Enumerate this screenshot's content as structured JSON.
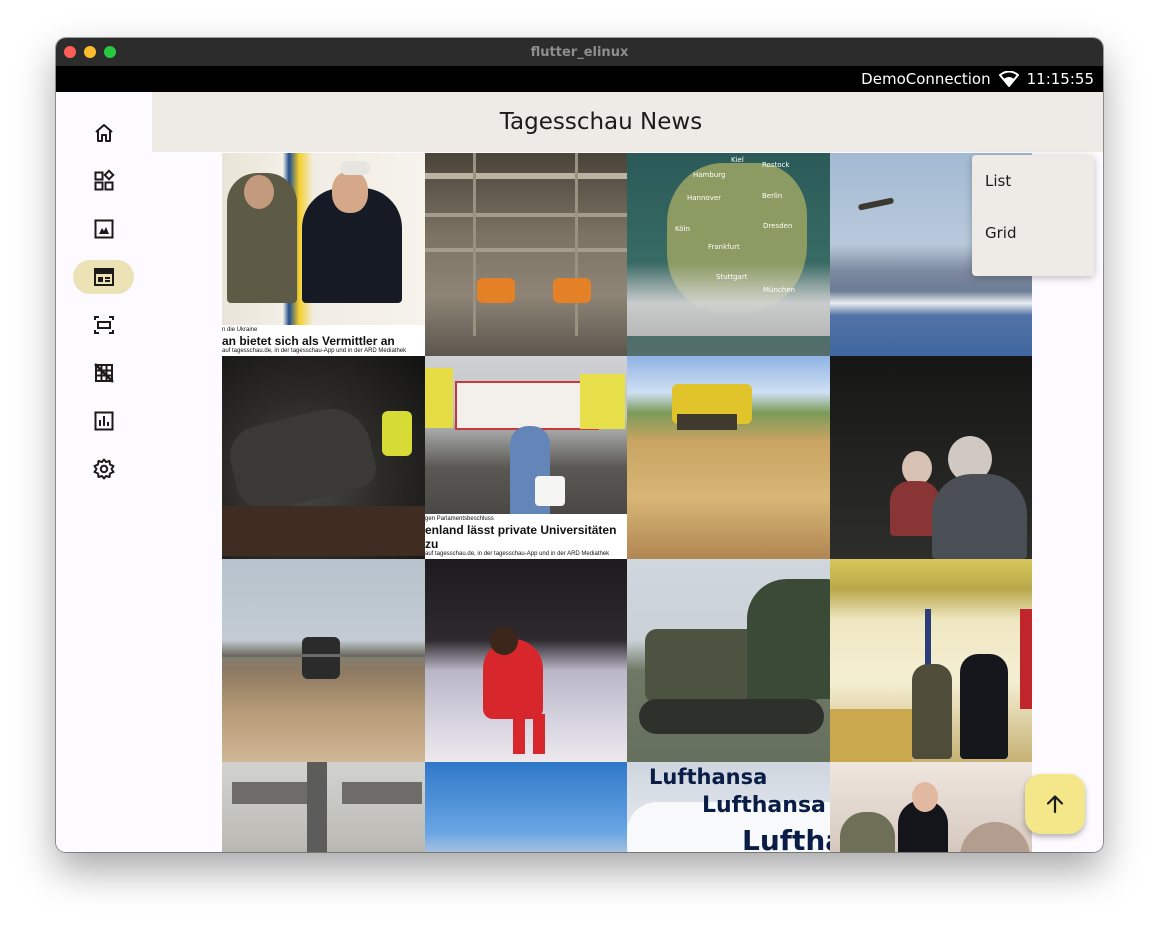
{
  "window": {
    "title": "flutter_elinux"
  },
  "status_bar": {
    "connection": "DemoConnection",
    "time": "11:15:55",
    "wifi_icon": "wifi-icon"
  },
  "nav_rail": {
    "selected_index": 3,
    "items": [
      {
        "icon": "home-icon"
      },
      {
        "icon": "widgets-icon"
      },
      {
        "icon": "gallery-icon"
      },
      {
        "icon": "news-icon"
      },
      {
        "icon": "fit-screen-icon"
      },
      {
        "icon": "grid-off-icon"
      },
      {
        "icon": "chart-icon"
      },
      {
        "icon": "settings-icon"
      }
    ]
  },
  "app_bar": {
    "title": "Tagesschau News"
  },
  "view_menu": {
    "items": [
      {
        "label": "List"
      },
      {
        "label": "Grid"
      }
    ]
  },
  "news_grid": {
    "tiles": [
      {
        "subject": "Zelensky and Erdogan handshake",
        "caption_kicker": "n die Ukraine",
        "caption_headline": "an bietet sich als Vermittler an",
        "caption_source": "auf tagesschau.de, in der tagesschau-App und in der ARD Mediathek"
      },
      {
        "subject": "empty train car with orange seats"
      },
      {
        "subject": "weather map of Germany",
        "map_cities": [
          "Kiel",
          "Rostock",
          "Hamburg",
          "Hannover",
          "Berlin",
          "Köln",
          "Frankfurt",
          "Dresden",
          "Stuttgart",
          "München"
        ]
      },
      {
        "subject": "missile over coastline"
      },
      {
        "subject": "burned car wreck at night with police"
      },
      {
        "subject": "protest with banners",
        "caption_kicker": "gen Parlamentsbeschluss",
        "caption_headline": "enland lässt private Universitäten zu",
        "caption_source": "auf tagesschau.de, in der tagesschau-App und in der ARD Mediathek"
      },
      {
        "subject": "combine harvester in wheat field"
      },
      {
        "subject": "elderly women in dark room"
      },
      {
        "subject": "tractor spraying field"
      },
      {
        "subject": "footballer in red kit"
      },
      {
        "subject": "armoured vehicle in forest"
      },
      {
        "subject": "Zelensky and Erdogan in palace"
      },
      {
        "subject": "building with police"
      },
      {
        "subject": "coastal city view"
      },
      {
        "subject": "Lufthansa aircraft",
        "brand_text": [
          "Lufthansa",
          "Lufthansa",
          "Luftha"
        ]
      },
      {
        "subject": "politician with soldiers"
      }
    ]
  },
  "fab": {
    "icon": "arrow-up-icon"
  },
  "colors": {
    "rail_selected": "#ebe3b6",
    "app_bar_bg": "#eeebe6",
    "fab_bg": "#f3e78a",
    "status_bar_bg": "#000000"
  }
}
